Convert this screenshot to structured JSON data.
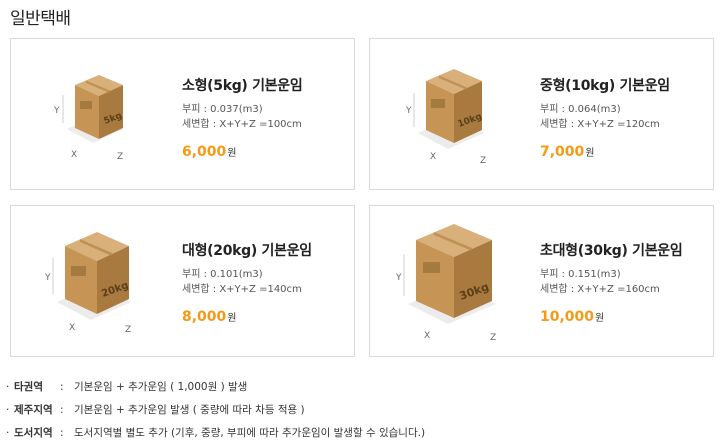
{
  "page_title": "일반택배",
  "cards": [
    {
      "name": "소형(5kg) 기본운임",
      "volume": "부피 : 0.037(m3)",
      "dims": "세변합 : X+Y+Z =100cm",
      "price": "6,000",
      "unit": "원",
      "weight_label": "5kg"
    },
    {
      "name": "중형(10kg) 기본운임",
      "volume": "부피 : 0.064(m3)",
      "dims": "세변합 : X+Y+Z =120cm",
      "price": "7,000",
      "unit": "원",
      "weight_label": "10kg"
    },
    {
      "name": "대형(20kg) 기본운임",
      "volume": "부피 : 0.101(m3)",
      "dims": "세변합 : X+Y+Z =140cm",
      "price": "8,000",
      "unit": "원",
      "weight_label": "20kg"
    },
    {
      "name": "초대형(30kg) 기본운임",
      "volume": "부피 : 0.151(m3)",
      "dims": "세변합 : X+Y+Z =160cm",
      "price": "10,000",
      "unit": "원",
      "weight_label": "30kg"
    }
  ],
  "axis_labels": {
    "x": "X",
    "y": "Y",
    "z": "Z"
  },
  "notes": [
    {
      "bullet": "·",
      "label": "타권역",
      "colon": ":",
      "text": "기본운임 + 추가운임 ( 1,000원 ) 발생"
    },
    {
      "bullet": "·",
      "label": "제주지역",
      "colon": ":",
      "text": "기본운임 + 추가운임 발생 ( 중량에 따라 차등 적용 )"
    },
    {
      "bullet": "·",
      "label": "도서지역",
      "colon": ":",
      "text": "도서지역별 별도 추가 (기후, 중량, 부피에 따라 추가운임이 발생할 수 있습니다.)"
    }
  ],
  "colors": {
    "accent": "#f39a16",
    "border": "#d9d9d9",
    "box_top": "#d9b07a",
    "box_left": "#c69455",
    "box_right": "#a97a40"
  }
}
